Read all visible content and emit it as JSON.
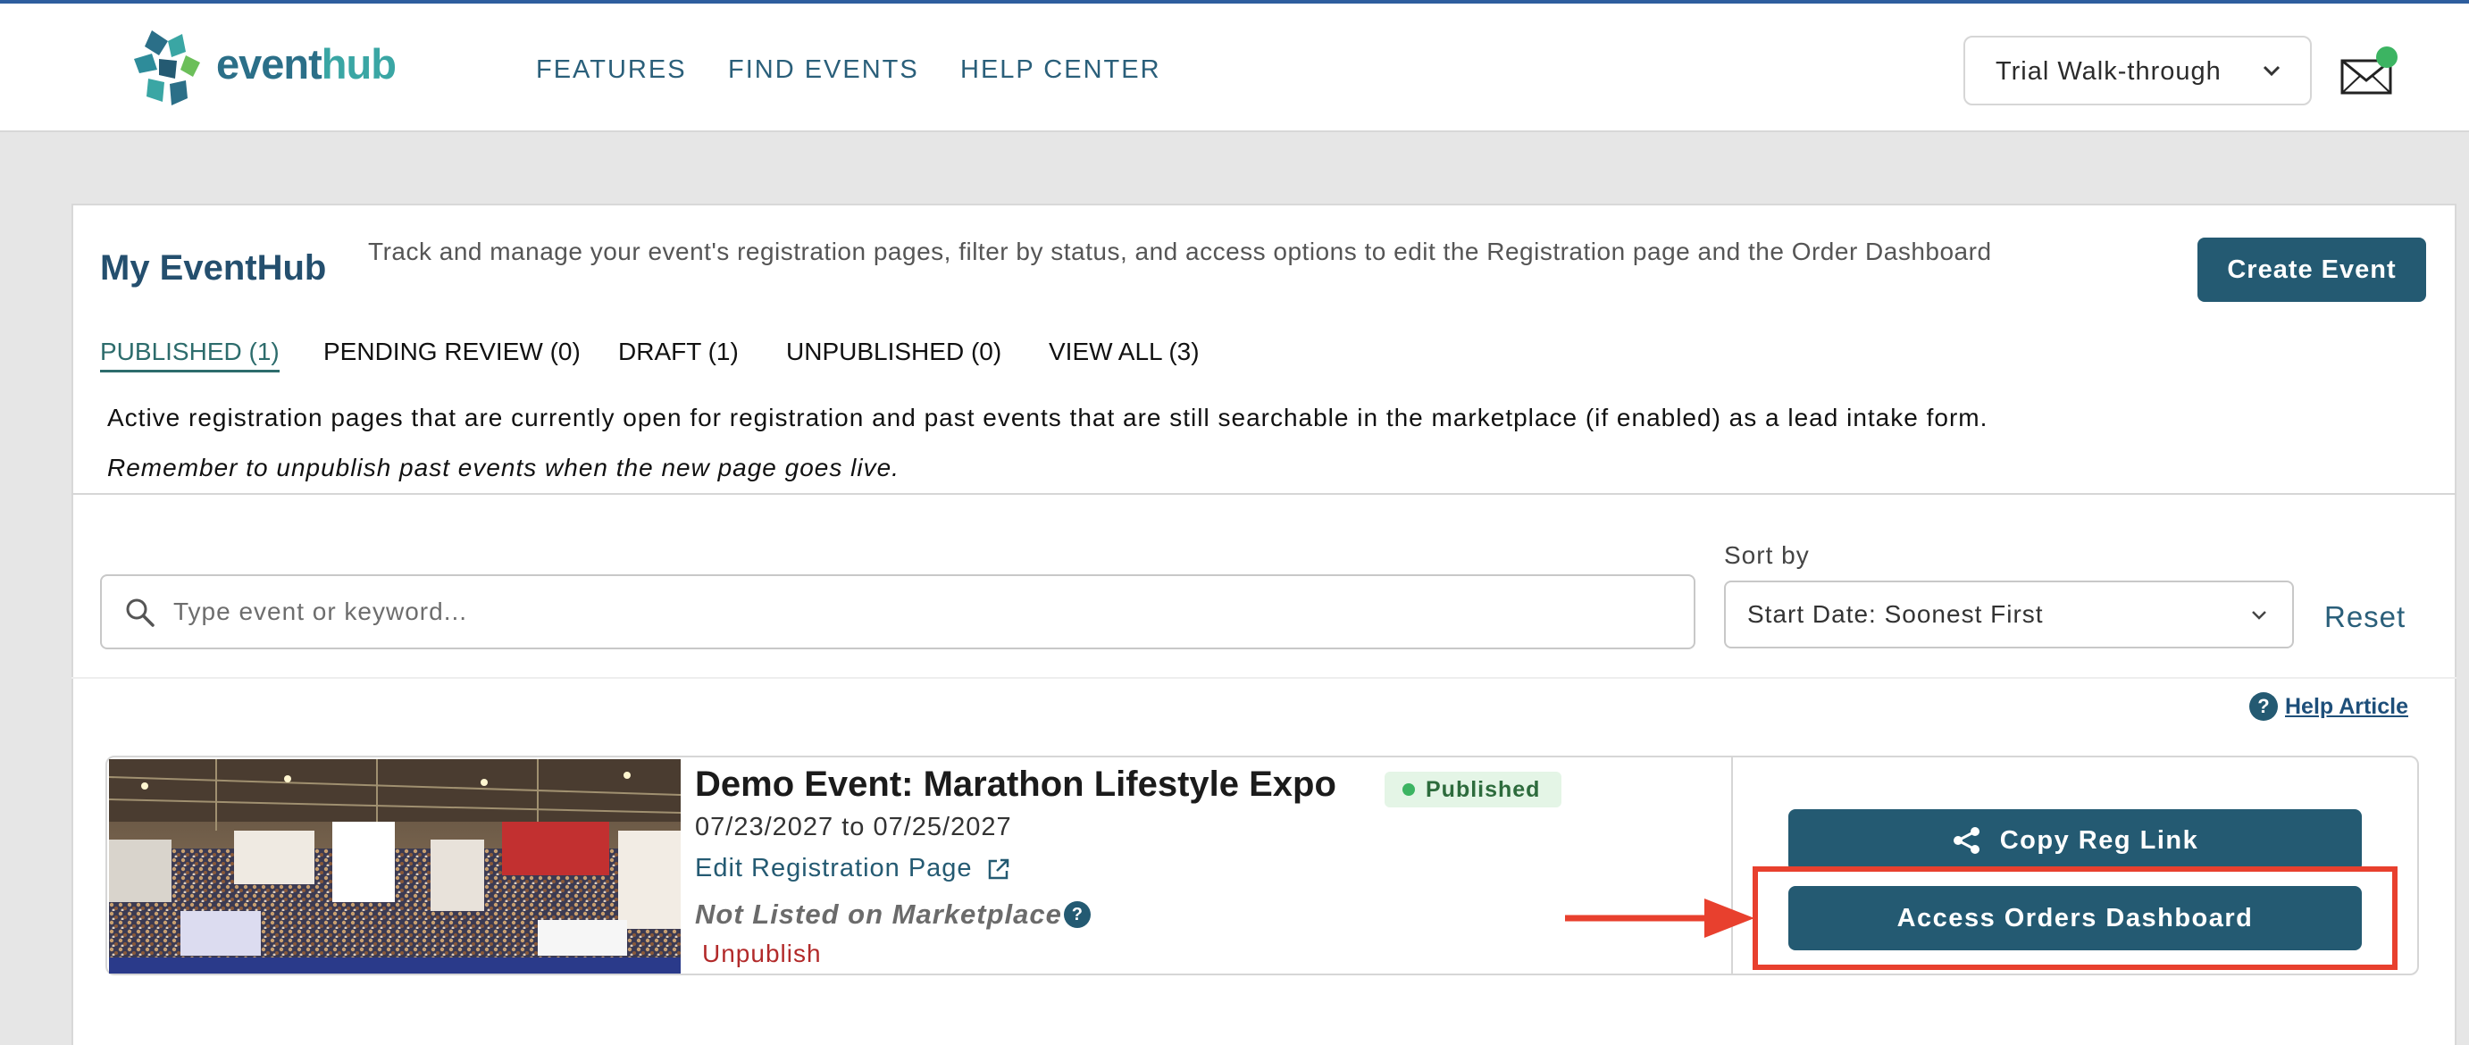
{
  "header": {
    "logo_event": "event",
    "logo_hub": "hub",
    "nav": [
      {
        "label": "FEATURES"
      },
      {
        "label": "FIND EVENTS"
      },
      {
        "label": "HELP CENTER"
      }
    ],
    "account_select": "Trial Walk-through",
    "mail_icon": "envelope-icon",
    "notification_color": "#3cb462"
  },
  "page": {
    "title": "My EventHub",
    "description": "Track and manage your event's registration pages, filter by status, and access options to edit the Registration page and the Order Dashboard",
    "create_button": "Create Event"
  },
  "tabs": [
    {
      "label": "PUBLISHED (1)",
      "active": true
    },
    {
      "label": "PENDING REVIEW (0)",
      "active": false
    },
    {
      "label": "DRAFT (1)",
      "active": false
    },
    {
      "label": "UNPUBLISHED (0)",
      "active": false
    },
    {
      "label": "VIEW ALL (3)",
      "active": false
    }
  ],
  "info": {
    "line1": "Active registration pages that are currently open for registration and past events that are still searchable in the marketplace (if enabled) as a lead intake form.",
    "line2": "Remember to unpublish past events when the new page goes live."
  },
  "filters": {
    "search_placeholder": "Type event or keyword...",
    "search_value": "",
    "sort_label": "Sort by",
    "sort_value": "Start Date: Soonest First",
    "reset": "Reset"
  },
  "help_article": {
    "icon": "?",
    "label": "Help Article"
  },
  "events": [
    {
      "title": "Demo Event: Marathon Lifestyle Expo",
      "status": "Published",
      "dates": "07/23/2027 to 07/25/2027",
      "edit_link": "Edit Registration Page",
      "marketplace": "Not Listed on Marketplace",
      "marketplace_help": "?",
      "unpublish": "Unpublish",
      "copy_button": "Copy Reg Link",
      "orders_button": "Access Orders Dashboard"
    }
  ],
  "colors": {
    "brand": "#245a72",
    "accent_teal": "#3aa6a4",
    "published_green": "#3cb462",
    "annotation_red": "#e8402e",
    "unpublish_red": "#b22a2a"
  }
}
